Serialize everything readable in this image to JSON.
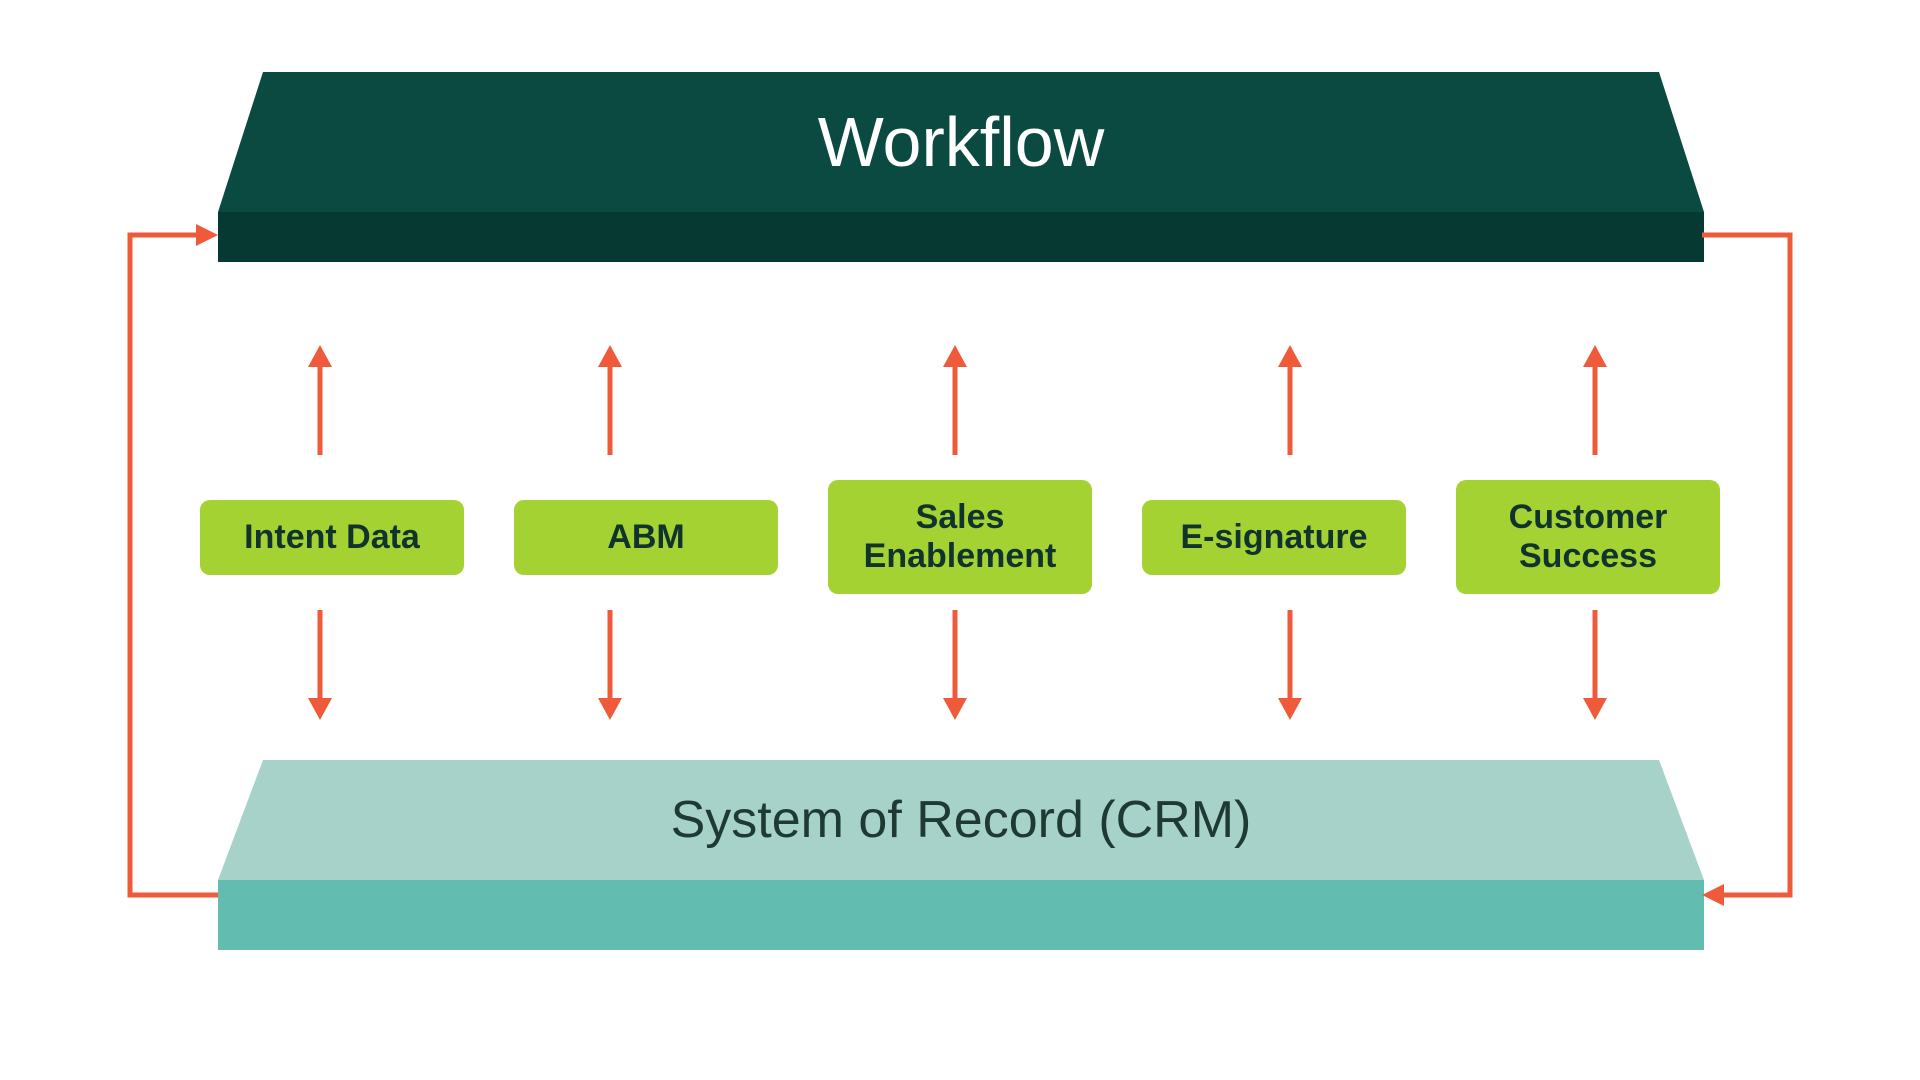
{
  "colors": {
    "arrow": "#ee5a3a",
    "category_bg": "#a4d233",
    "workflow_top": "#0b4a41",
    "workflow_side": "#063931",
    "crm_top": "#a6d2ca",
    "crm_side": "#62bdb0"
  },
  "top_layer": {
    "label": "Workflow"
  },
  "bottom_layer": {
    "label": "System of Record (CRM)"
  },
  "categories": [
    {
      "label": "Intent Data"
    },
    {
      "label": "ABM"
    },
    {
      "label": "Sales\nEnablement"
    },
    {
      "label": "E-signature"
    },
    {
      "label": "Customer\nSuccess"
    }
  ],
  "flows": {
    "each_category_to_workflow": "up-arrow",
    "each_category_to_crm": "down-arrow",
    "left_loop": "crm-to-workflow",
    "right_loop": "workflow-to-crm"
  }
}
